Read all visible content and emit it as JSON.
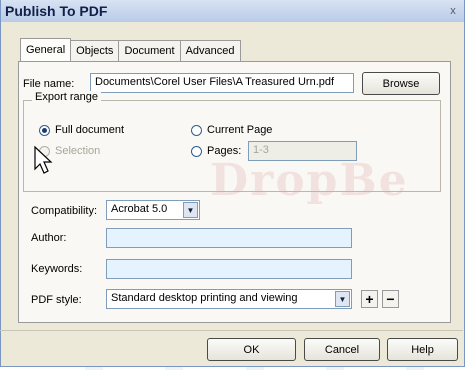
{
  "window": {
    "title": "Publish To PDF",
    "close_glyph": "x"
  },
  "tabs": [
    {
      "label": "General"
    },
    {
      "label": "Objects"
    },
    {
      "label": "Document"
    },
    {
      "label": "Advanced"
    }
  ],
  "general": {
    "file_name_label": "File name:",
    "file_name_value": "Documents\\Corel User Files\\A Treasured Urn.pdf",
    "browse_label": "Browse",
    "export_range_label": "Export range",
    "full_document_label": "Full document",
    "current_page_label": "Current Page",
    "selection_label": "Selection",
    "pages_label": "Pages:",
    "pages_value": "1-3",
    "compatibility_label": "Compatibility:",
    "compatibility_value": "Acrobat 5.0",
    "author_label": "Author:",
    "author_value": "",
    "keywords_label": "Keywords:",
    "keywords_value": "",
    "pdf_style_label": "PDF style:",
    "pdf_style_value": "Standard desktop printing and viewing",
    "add_style_label": "+",
    "remove_style_label": "−"
  },
  "footer": {
    "ok_label": "OK",
    "cancel_label": "Cancel",
    "help_label": "Help"
  },
  "watermark": {
    "text": "DropBe"
  },
  "selected_radio": "full_document"
}
